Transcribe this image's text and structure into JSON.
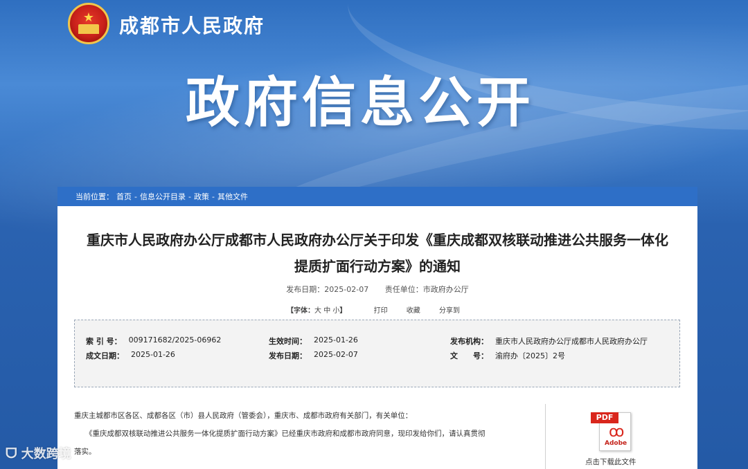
{
  "header": {
    "site_name": "成都市人民政府",
    "banner_title": "政府信息公开"
  },
  "breadcrumb": {
    "prefix": "当前位置：",
    "items": [
      "首页",
      "信息公开目录",
      "政策",
      "其他文件"
    ],
    "separator": " - "
  },
  "document": {
    "title_line1": "重庆市人民政府办公厅成都市人民政府办公厅关于印发《重庆成都双核联动推进公共服务一体化",
    "title_line2": "提质扩面行动方案》的通知",
    "publish_date_label": "发布日期：2025-02-07",
    "department_label": "责任单位：市政府办公厅"
  },
  "toolbar": {
    "fontsize_open": "【字体：",
    "size_large": "大",
    "size_medium": "中",
    "size_small": "小",
    "fontsize_close": "】",
    "print": "打印",
    "favorite": "收藏",
    "share": "分享到"
  },
  "info": {
    "index_label": "索 引 号：",
    "index_value": "009171682/2025-06962",
    "effective_label": "生效时间：",
    "effective_value": "2025-01-26",
    "issuer_label": "发布机构：",
    "issuer_value": "重庆市人民政府办公厅成都市人民政府办公厅",
    "written_label": "成文日期：",
    "written_value": "2025-01-26",
    "published_label": "发布日期：",
    "published_value": "2025-02-07",
    "docno_label": "文　　号：",
    "docno_value": "渝府办〔2025〕2号"
  },
  "body": {
    "para1": "重庆主城都市区各区、成都各区（市）县人民政府（管委会），重庆市、成都市政府有关部门，有关单位：",
    "para2": "《重庆成都双核联动推进公共服务一体化提质扩面行动方案》已经重庆市政府和成都市政府同意，现印发给你们，请认真贯彻",
    "para3": "落实。"
  },
  "download": {
    "pdf_tag": "PDF",
    "adobe_label": "Adobe",
    "caption": "点击下载此文件"
  },
  "watermark": {
    "text": "大数跨境"
  },
  "colors": {
    "brand_blue": "#2e6fc7",
    "banner_blue": "#2b63b1",
    "pdf_red": "#d9261c"
  }
}
